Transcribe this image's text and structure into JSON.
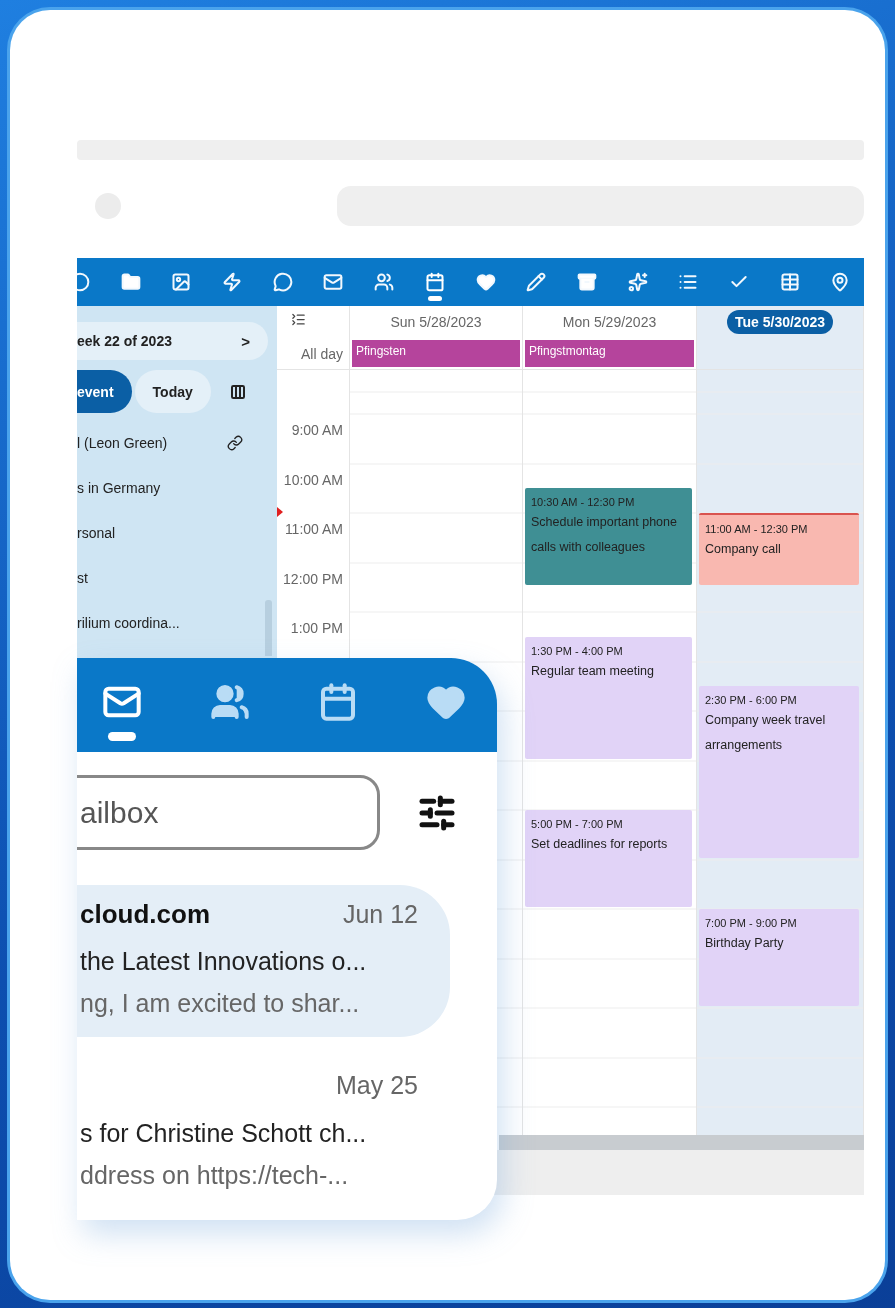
{
  "toolbar": [
    {
      "selected": false
    },
    {
      "selected": false
    },
    {
      "selected": false
    },
    {
      "selected": false
    },
    {
      "selected": false
    },
    {
      "selected": false
    },
    {
      "selected": false
    },
    {
      "selected": true
    },
    {
      "selected": false
    },
    {
      "selected": false
    },
    {
      "selected": false
    },
    {
      "selected": false
    },
    {
      "selected": false
    },
    {
      "selected": false
    },
    {
      "selected": false
    },
    {
      "selected": false
    }
  ],
  "sidebar": {
    "week": "eek 22 of 2023",
    "next": ">",
    "buttons": [
      {
        "label": "event",
        "selected": true
      },
      {
        "label": "Today",
        "selected": false
      }
    ],
    "calendars": [
      {
        "name": "l (Leon Green)",
        "linked": true
      },
      {
        "name": "s in Germany",
        "linked": false
      },
      {
        "name": "rsonal",
        "linked": false
      },
      {
        "name": "st",
        "linked": false
      },
      {
        "name": "rilium coordina...",
        "linked": false
      }
    ]
  },
  "calendar": {
    "all_day_label": "All day",
    "time_labels": [
      "9:00 AM",
      "10:00 AM",
      "11:00 AM",
      "12:00 PM",
      "1:00 PM"
    ],
    "days": [
      {
        "label": "Sun 5/28/2023",
        "today": false,
        "all_day": [
          {
            "title": "Pfingsten",
            "color": "#b5449c"
          }
        ]
      },
      {
        "label": "Mon 5/29/2023",
        "today": false,
        "all_day": [
          {
            "title": "Pfingstmontag",
            "color": "#b5449c"
          }
        ],
        "events": [
          {
            "time": "10:30 AM - 12:30 PM",
            "title": "Schedule important phone calls with colleagues",
            "color": "#3f8f94"
          },
          {
            "time": "1:30 PM - 4:00 PM",
            "title": "Regular team meeting",
            "color": "#e1d3f7"
          },
          {
            "time": "5:00 PM - 7:00 PM",
            "title": "Set deadlines for reports",
            "color": "#e1d3f7"
          }
        ]
      },
      {
        "label": "Tue 5/30/2023",
        "today": true,
        "events": [
          {
            "time": "11:00 AM - 12:30 PM",
            "title": "Company call",
            "color": "#f9b8b0"
          },
          {
            "time": "2:30 PM - 6:00 PM",
            "title": "Company week travel arrangements",
            "color": "#e1d3f7"
          },
          {
            "time": "7:00 PM - 9:00 PM",
            "title": "Birthday Party",
            "color": "#e1d3f7"
          }
        ]
      }
    ]
  },
  "mail": {
    "tabs": [
      {
        "selected": true
      },
      {
        "selected": false
      },
      {
        "selected": false
      },
      {
        "selected": false
      }
    ],
    "search": {
      "placeholder": "ailbox"
    },
    "messages": [
      {
        "sender": "cloud.com",
        "date": "Jun 12",
        "subject": "the Latest Innovations o...",
        "preview": "ng, I am excited to shar...",
        "selected": true
      },
      {
        "date": "May 25",
        "subject": "s for Christine Schott ch...",
        "preview": "ddress on https://tech-...",
        "selected": false
      }
    ]
  }
}
